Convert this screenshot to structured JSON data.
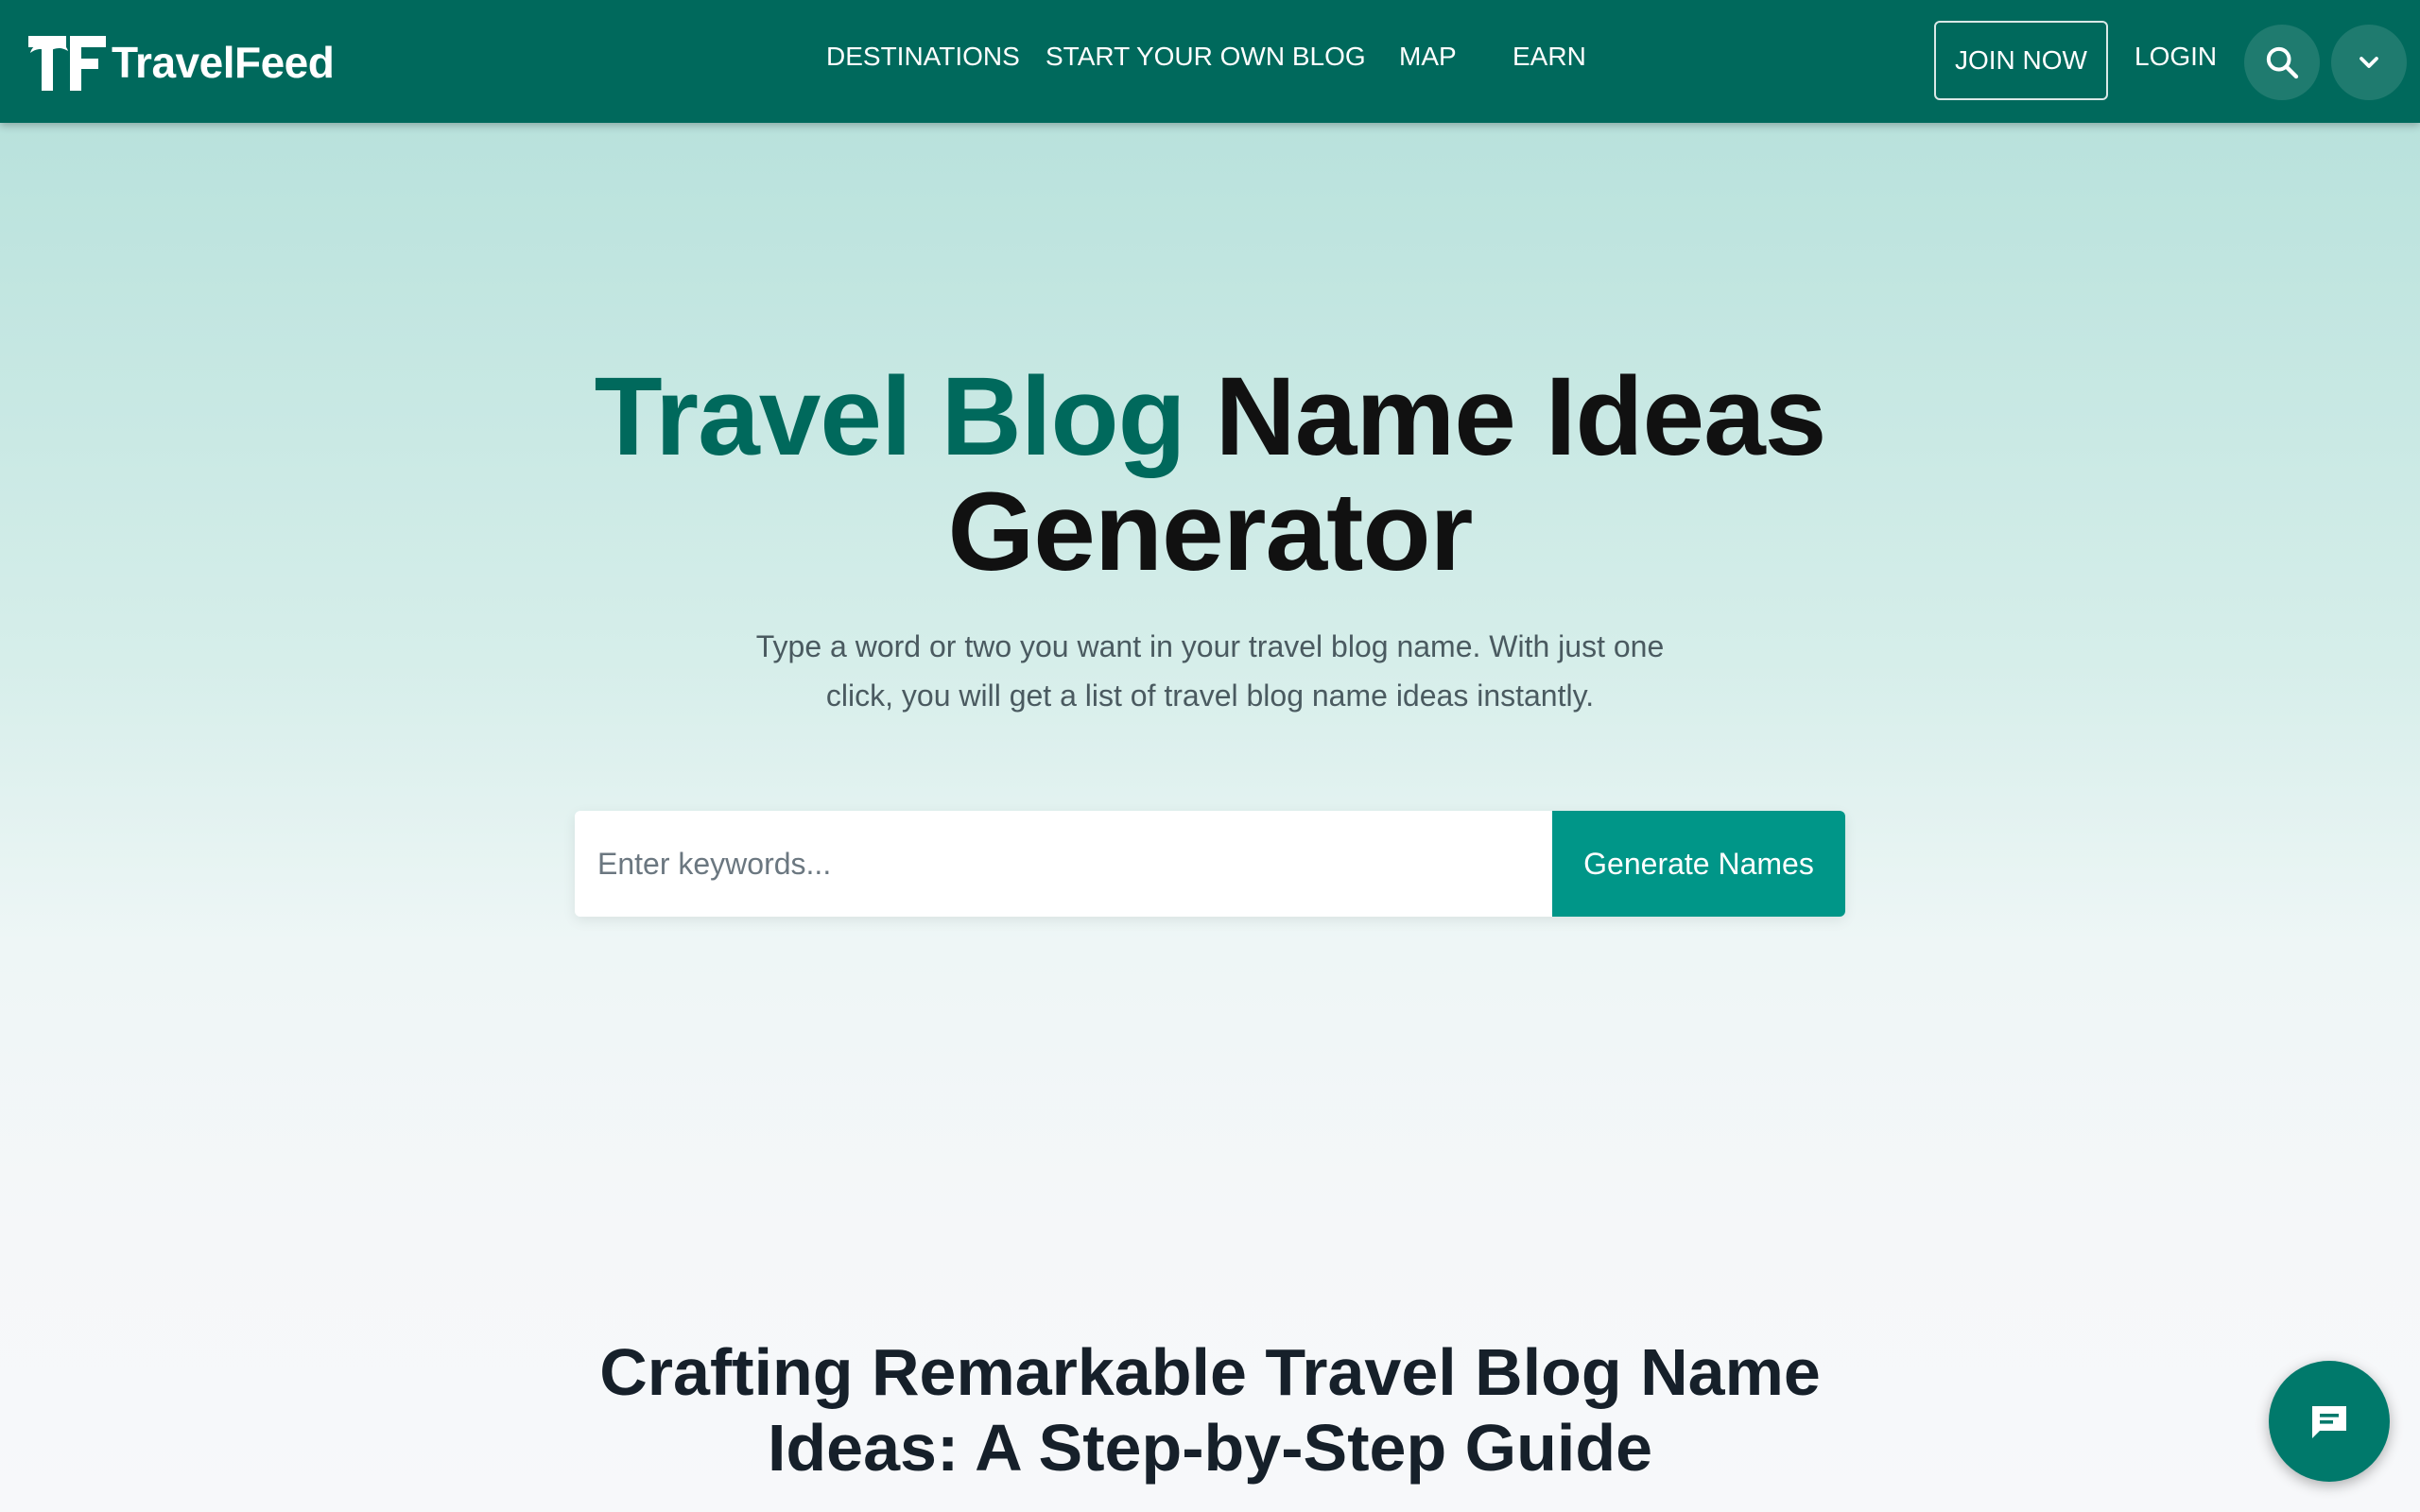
{
  "brand": {
    "name": "TravelFeed"
  },
  "nav": {
    "items": [
      {
        "label": "DESTINATIONS"
      },
      {
        "label": "START YOUR OWN BLOG"
      },
      {
        "label": "MAP"
      },
      {
        "label": "EARN"
      }
    ],
    "join_label": "JOIN NOW",
    "login_label": "LOGIN",
    "search_icon": "search-icon",
    "menu_icon": "chevron-down-icon"
  },
  "hero": {
    "title_accent": "Travel Blog",
    "title_rest": " Name Ideas",
    "title_line2": "Generator",
    "subtitle": "Type a word or two you want in your travel blog name. With just one click, you will get a list of travel blog name ideas instantly.",
    "input_placeholder": "Enter keywords...",
    "input_value": "",
    "button_label": "Generate Names"
  },
  "guide": {
    "title_line1": "Crafting Remarkable Travel Blog Name",
    "title_line2": "Ideas: A Step-by-Step Guide"
  },
  "chat": {
    "icon": "chat-icon"
  },
  "colors": {
    "header_bg": "#00695c",
    "accent": "#00695c",
    "button_bg": "#009688",
    "chat_bg": "#00796b"
  }
}
